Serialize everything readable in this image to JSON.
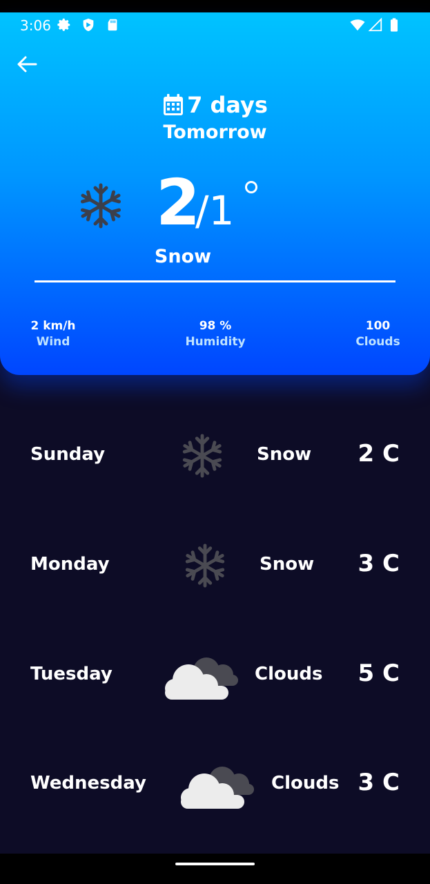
{
  "status_bar": {
    "time": "3:06",
    "icons": [
      "settings-icon",
      "shield-icon",
      "sd-card-icon",
      "wifi-icon",
      "signal-icon",
      "battery-icon"
    ]
  },
  "header": {
    "range_title": "7 days",
    "day_title": "Tomorrow"
  },
  "current": {
    "temp_high": "2",
    "temp_low": "/1",
    "condition": "Snow",
    "icon": "snowflake-icon"
  },
  "stats": {
    "wind": {
      "value": "2 km/h",
      "label": "Wind"
    },
    "humidity": {
      "value": "98 %",
      "label": "Humidity"
    },
    "clouds": {
      "value": "100",
      "label": "Clouds"
    }
  },
  "forecast": [
    {
      "day": "Sunday",
      "icon": "snowflake-icon",
      "condition": "Snow",
      "temp": "2 C"
    },
    {
      "day": "Monday",
      "icon": "snowflake-icon",
      "condition": "Snow",
      "temp": "3 C"
    },
    {
      "day": "Tuesday",
      "icon": "clouds-icon",
      "condition": "Clouds",
      "temp": "5 C"
    },
    {
      "day": "Wednesday",
      "icon": "clouds-icon",
      "condition": "Clouds",
      "temp": "3 C"
    }
  ],
  "colors": {
    "gradient_top": "#00c3ff",
    "gradient_bottom": "#0046ff",
    "background": "#0d0c26",
    "icon_gray": "#4a4a52"
  }
}
